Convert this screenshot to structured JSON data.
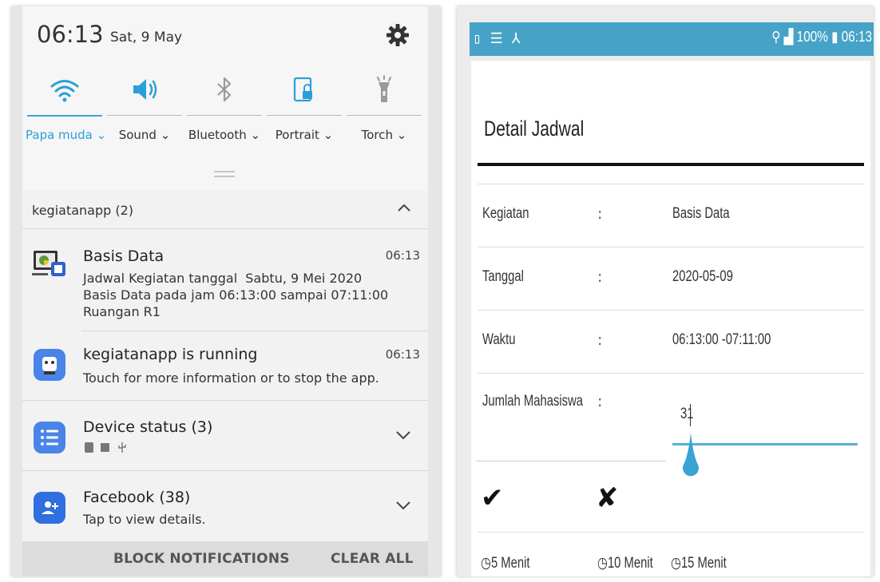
{
  "left_phone": {
    "status": {
      "time": "06:13",
      "date": "Sat, 9 May",
      "settings_icon": "gear-icon"
    },
    "quick_settings": [
      {
        "label": "Papa muda",
        "icon": "wifi-icon",
        "active": true
      },
      {
        "label": "Sound",
        "icon": "volume-icon",
        "active": true
      },
      {
        "label": "Bluetooth",
        "icon": "bluetooth-icon",
        "active": false
      },
      {
        "label": "Portrait",
        "icon": "rotation-lock-icon",
        "active": false
      },
      {
        "label": "Torch",
        "icon": "flashlight-icon",
        "active": false
      }
    ],
    "group": {
      "title": "kegiatanapp (2)"
    },
    "notifications": [
      {
        "title": "Basis Data",
        "time": "06:13",
        "lines": [
          "Jadwal Kegiatan tanggal  Sabtu, 9 Mei 2020",
          "Basis Data pada jam 06:13:00 sampai 07:11:00",
          "Ruangan R1"
        ]
      },
      {
        "title": "kegiatanapp is running",
        "time": "06:13",
        "lines": [
          "Touch for more information or to stop the app."
        ]
      },
      {
        "title": "Device status (3)",
        "lines": []
      },
      {
        "title": "Facebook (38)",
        "lines": [
          "Tap to view details."
        ]
      }
    ],
    "actions": {
      "block": "BLOCK NOTIFICATIONS",
      "clear": "CLEAR ALL"
    }
  },
  "right_phone": {
    "statusbar": {
      "left_icons": "▯ ☰ ⅄",
      "right_text": "100% 06:13",
      "battery": "100%",
      "time": "06:13"
    },
    "title": "Detail Jadwal",
    "fields": [
      {
        "label": "Kegiatan",
        "sep": ":",
        "value": "Basis Data"
      },
      {
        "label": "Tanggal",
        "sep": ":",
        "value": "2020-05-09"
      },
      {
        "label": "Waktu",
        "sep": ":",
        "value": "06:13:00 -07:11:00"
      },
      {
        "label": "Jumlah Mahasiswa",
        "sep": ":",
        "value": "31"
      }
    ],
    "slider_value": 31,
    "actions": {
      "confirm": "✔",
      "cancel": "✘"
    },
    "timers": [
      "5 Menit",
      "10 Menit",
      "15 Menit"
    ],
    "accent": "#46a3c7"
  }
}
